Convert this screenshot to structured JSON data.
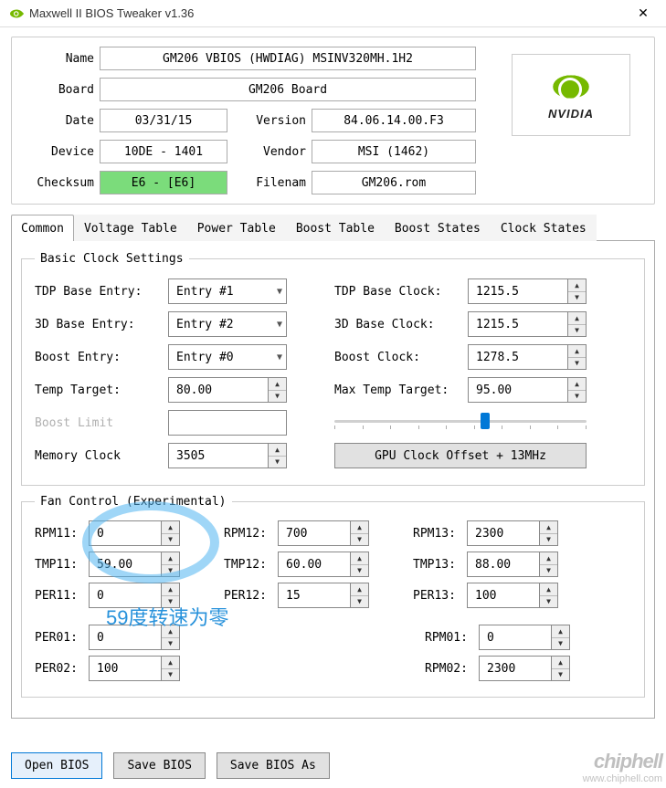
{
  "window": {
    "title": "Maxwell II BIOS Tweaker v1.36"
  },
  "info": {
    "name_label": "Name",
    "name": "GM206 VBIOS (HWDIAG) MSINV320MH.1H2",
    "board_label": "Board",
    "board": "GM206 Board",
    "date_label": "Date",
    "date": "03/31/15",
    "version_label": "Version",
    "version": "84.06.14.00.F3",
    "device_label": "Device",
    "device": "10DE - 1401",
    "vendor_label": "Vendor",
    "vendor": "MSI (1462)",
    "checksum_label": "Checksum",
    "checksum": "E6 - [E6]",
    "filename_label": "Filenam",
    "filename": "GM206.rom",
    "logo_text": "NVIDIA"
  },
  "tabs": {
    "t0": "Common",
    "t1": "Voltage Table",
    "t2": "Power Table",
    "t3": "Boost Table",
    "t4": "Boost States",
    "t5": "Clock States"
  },
  "basic": {
    "legend": "Basic Clock Settings",
    "tdp_base_entry_label": "TDP Base Entry:",
    "tdp_base_entry": "Entry #1",
    "tdp_base_clock_label": "TDP Base Clock:",
    "tdp_base_clock": "1215.5",
    "three_d_base_entry_label": "3D Base Entry:",
    "three_d_base_entry": "Entry #2",
    "three_d_base_clock_label": "3D Base Clock:",
    "three_d_base_clock": "1215.5",
    "boost_entry_label": "Boost Entry:",
    "boost_entry": "Entry #0",
    "boost_clock_label": "Boost Clock:",
    "boost_clock": "1278.5",
    "temp_target_label": "Temp Target:",
    "temp_target": "80.00",
    "max_temp_target_label": "Max Temp Target:",
    "max_temp_target": "95.00",
    "boost_limit_label": "Boost Limit",
    "boost_limit": "",
    "memory_clock_label": "Memory Clock",
    "memory_clock": "3505",
    "gpu_offset_button": "GPU Clock Offset + 13MHz"
  },
  "fan": {
    "legend": "Fan Control (Experimental)",
    "rpm11_l": "RPM11:",
    "rpm11": "0",
    "rpm12_l": "RPM12:",
    "rpm12": "700",
    "rpm13_l": "RPM13:",
    "rpm13": "2300",
    "tmp11_l": "TMP11:",
    "tmp11": "59.00",
    "tmp12_l": "TMP12:",
    "tmp12": "60.00",
    "tmp13_l": "TMP13:",
    "tmp13": "88.00",
    "per11_l": "PER11:",
    "per11": "0",
    "per12_l": "PER12:",
    "per12": "15",
    "per13_l": "PER13:",
    "per13": "100",
    "per01_l": "PER01:",
    "per01": "0",
    "rpm01_l": "RPM01:",
    "rpm01": "0",
    "per02_l": "PER02:",
    "per02": "100",
    "rpm02_l": "RPM02:",
    "rpm02": "2300"
  },
  "footer": {
    "open": "Open BIOS",
    "save": "Save BIOS",
    "saveas": "Save BIOS As"
  },
  "annotation": "59度转速为零",
  "watermark": {
    "brand": "chiphell",
    "url": "www.chiphell.com"
  }
}
